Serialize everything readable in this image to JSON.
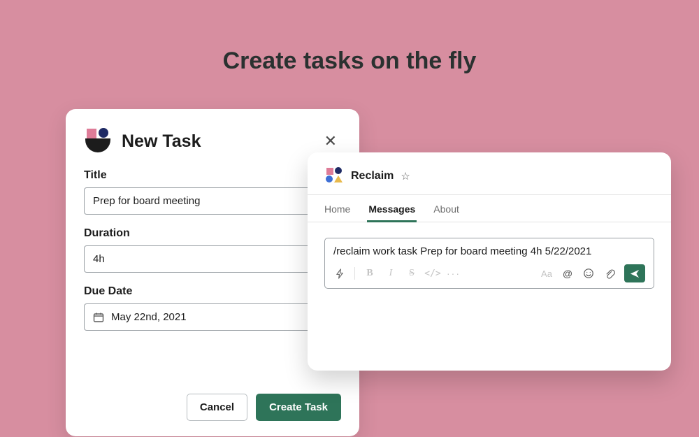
{
  "hero": {
    "title": "Create tasks on the fly"
  },
  "task_modal": {
    "heading": "New Task",
    "fields": {
      "title_label": "Title",
      "title_value": "Prep for board meeting",
      "duration_label": "Duration",
      "duration_value": "4h",
      "due_label": "Due Date",
      "due_value": "May 22nd, 2021"
    },
    "buttons": {
      "cancel": "Cancel",
      "create": "Create Task"
    }
  },
  "slack": {
    "app_name": "Reclaim",
    "tabs": [
      {
        "label": "Home",
        "active": false
      },
      {
        "label": "Messages",
        "active": true
      },
      {
        "label": "About",
        "active": false
      }
    ],
    "composer_text": "/reclaim work task Prep for board meeting 4h 5/22/2021",
    "toolbar": {
      "bold": "B",
      "italic": "I",
      "strike": "S",
      "code": "</>",
      "more": "···",
      "font": "Aa",
      "mention": "@",
      "emoji": "☺",
      "attach": "📎"
    }
  }
}
